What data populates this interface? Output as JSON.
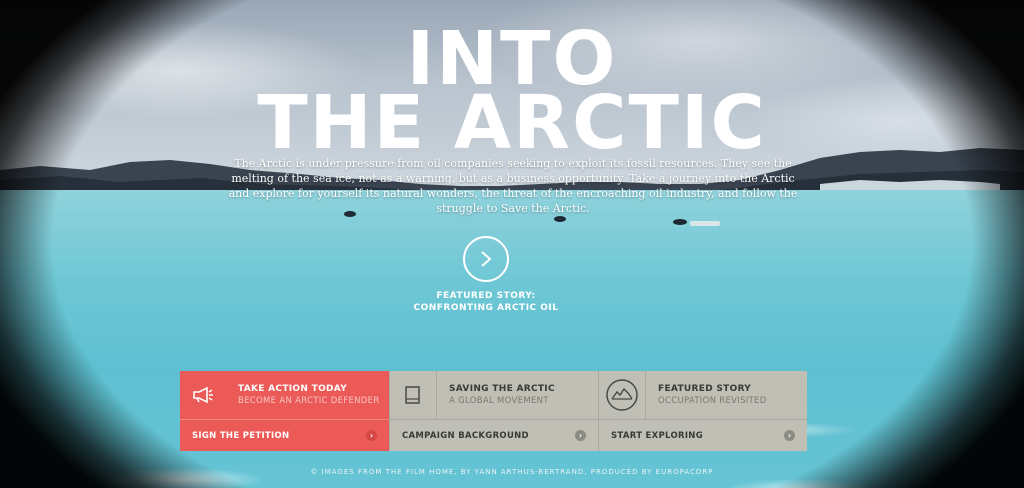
{
  "hero": {
    "title_line1": "INTO",
    "title_line2": "THE ARCTIC",
    "intro": "The Arctic is under pressure from oil companies seeking to exploit its fossil resources. They see the melting of the sea ice, not as a warning, but as a business opportunity. Take a journey into the Arctic and explore for yourself its natural wonders, the threat of the encroaching oil industry, and follow the struggle to Save the Arctic.",
    "play_icon": "chevron-right-icon",
    "featured_line1": "FEATURED STORY:",
    "featured_line2": "CONFRONTING ARCTIC OIL"
  },
  "panels": [
    {
      "icon": "megaphone-icon",
      "heading": "TAKE ACTION TODAY",
      "sub": "BECOME AN ARCTIC DEFENDER",
      "link": "SIGN THE PETITION",
      "color": "#ec5a57"
    },
    {
      "icon": "book-icon",
      "heading": "SAVING THE ARCTIC",
      "sub": "A GLOBAL MOVEMENT",
      "link": "CAMPAIGN BACKGROUND",
      "color": "#bfbfb5"
    },
    {
      "icon": "mountain-circle-icon",
      "heading": "FEATURED STORY",
      "sub": "OCCUPATION REVISITED",
      "link": "START EXPLORING",
      "color": "#bfbfb5"
    }
  ],
  "chevron": "›",
  "credit": "© IMAGES FROM THE FILM HOME, BY YANN ARTHUS-BERTRAND, PRODUCED BY EUROPACORP"
}
